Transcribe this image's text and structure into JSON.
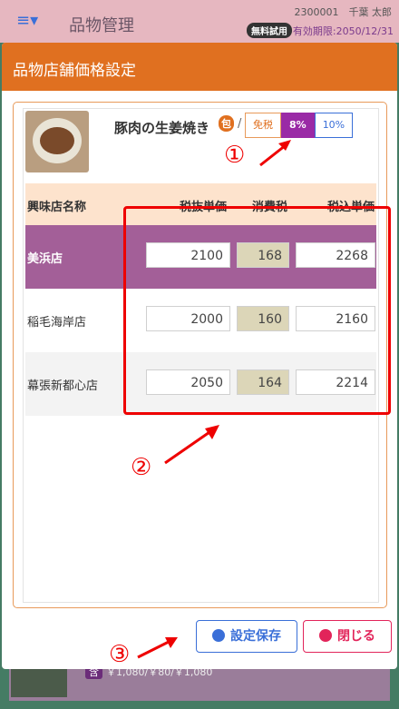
{
  "app": {
    "title": "品物管理",
    "user": "2300001　千葉 太郎",
    "trial_badge": "無料試用",
    "expiry": "有効期限:2050/12/31"
  },
  "modal": {
    "title": "品物店舗価格設定"
  },
  "product": {
    "name": "豚肉の生姜焼き",
    "pack_tag": "包",
    "slash": "/"
  },
  "tax_buttons": [
    "免税",
    "8%",
    "10%"
  ],
  "table": {
    "headers": [
      "興味店名称",
      "税抜単価",
      "消費税",
      "税込単価"
    ],
    "rows": [
      {
        "store": "美浜店",
        "ex_tax": "2100",
        "tax": "168",
        "inc_tax": "2268"
      },
      {
        "store": "稲毛海岸店",
        "ex_tax": "2000",
        "tax": "160",
        "inc_tax": "2160"
      },
      {
        "store": "幕張新都心店",
        "ex_tax": "2050",
        "tax": "164",
        "inc_tax": "2214"
      }
    ]
  },
  "annotations": [
    "①",
    "②",
    "③"
  ],
  "buttons": {
    "save": "設定保存",
    "close": "閉じる"
  },
  "background_row": {
    "tag": "含",
    "text": "￥1,080/￥80/￥1,080"
  }
}
